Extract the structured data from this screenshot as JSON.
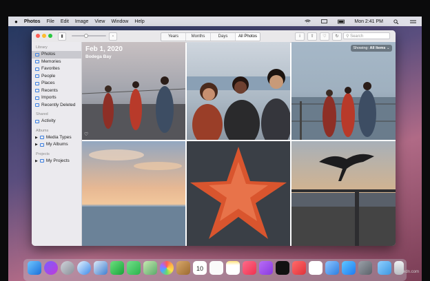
{
  "menubar": {
    "app": "Photos",
    "items": [
      "File",
      "Edit",
      "Image",
      "View",
      "Window",
      "Help"
    ],
    "clock": "Mon 2:41 PM"
  },
  "toolbar": {
    "tabs": [
      "Years",
      "Months",
      "Days",
      "All Photos"
    ],
    "selected_tab": "All Photos",
    "search_placeholder": "Search"
  },
  "sidebar": {
    "library_header": "Library",
    "library_items": [
      "Photos",
      "Memories",
      "Favorites",
      "People",
      "Places",
      "Recents",
      "Imports",
      "Recently Deleted"
    ],
    "selected": "Photos",
    "shared_header": "Shared",
    "shared_items": [
      "Activity"
    ],
    "albums_header": "Albums",
    "albums_items": [
      "Media Types",
      "My Albums"
    ],
    "projects_header": "Projects",
    "projects_items": [
      "My Projects"
    ]
  },
  "main": {
    "date": "Feb 1, 2020",
    "location": "Bodega Bay",
    "showing_label": "Showing:",
    "showing_value": "All Items"
  },
  "dock": {
    "calendar_day": "10"
  },
  "watermark": "wsxdn.com"
}
